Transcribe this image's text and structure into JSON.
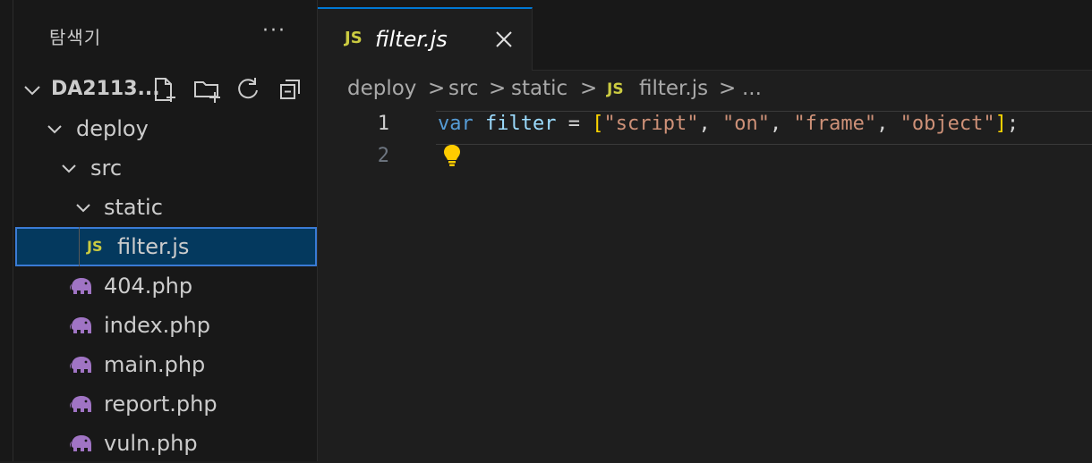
{
  "explorer": {
    "title": "탐색기",
    "more_label": "···",
    "root_label": "DA2113...",
    "toolbar_icons": [
      "new-file-icon",
      "new-folder-icon",
      "refresh-icon",
      "collapse-all-icon"
    ]
  },
  "tree": {
    "deploy": "deploy",
    "src": "src",
    "static": "static",
    "filter": "filter.js",
    "js_badge": "JS",
    "files": [
      "404.php",
      "index.php",
      "main.php",
      "report.php",
      "vuln.php"
    ]
  },
  "tab": {
    "badge": "JS",
    "title": "filter.js"
  },
  "breadcrumb": {
    "items": [
      "deploy",
      "src",
      "static",
      "filter.js",
      "..."
    ],
    "badge": "JS",
    "separator": ">"
  },
  "editor": {
    "line_numbers": [
      "1",
      "2"
    ],
    "tokens": {
      "kw": "var",
      "ident": "filter",
      "op": " = ",
      "open": "[",
      "s1": "\"script\"",
      "s2": "\"on\"",
      "s3": "\"frame\"",
      "s4": "\"object\"",
      "comma": ", ",
      "close": "]",
      "semi": ";"
    },
    "colors": {
      "keyword": "#569cd6",
      "identifier": "#9cdcfe",
      "string": "#ce9178",
      "bracket": "#ffd700",
      "active_tab_border": "#0078d4",
      "selection": "#04395e",
      "js_badge": "#cbcb41",
      "php_icon": "#a074c4"
    }
  }
}
